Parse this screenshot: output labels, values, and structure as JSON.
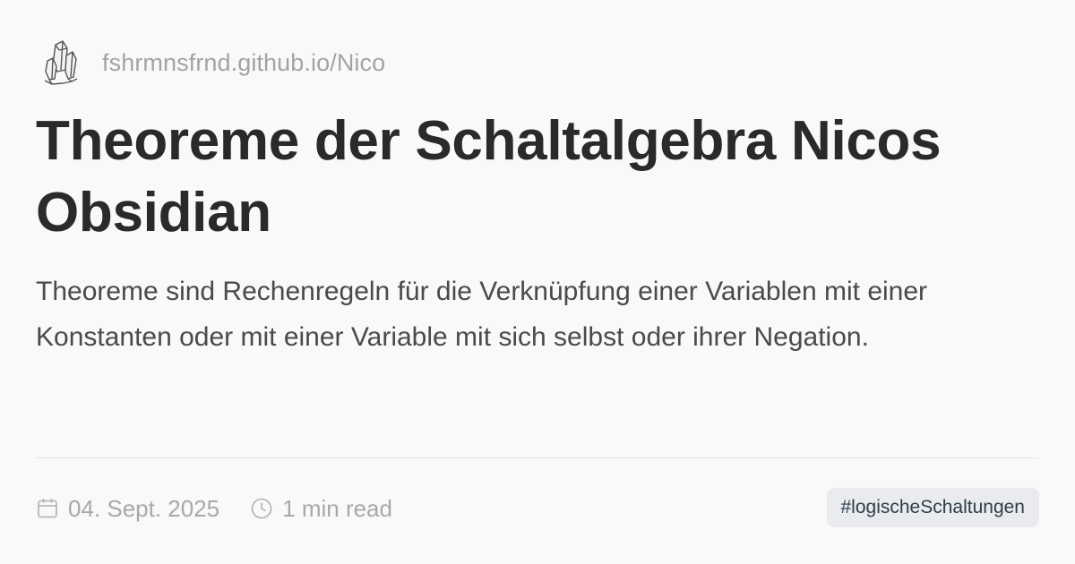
{
  "site": {
    "logo_icon": "crystal-icon",
    "url": "fshrmnsfrnd.github.io/Nico"
  },
  "article": {
    "title": "Theoreme der Schaltalgebra Nicos Obsidian",
    "description": "Theoreme sind Rechenregeln für die Verknüpfung einer Variablen mit einer Konstanten oder mit einer Variable mit sich selbst oder ihrer Negation."
  },
  "meta": {
    "date_icon": "calendar-icon",
    "date": "04. Sept. 2025",
    "reading_icon": "clock-icon",
    "reading_time": "1 min read",
    "tag": "#logischeSchaltungen"
  },
  "colors": {
    "background": "#faf9fa",
    "title": "#2a2a2a",
    "muted": "#a3a3a3",
    "tag_background": "#e9ebee",
    "tag_text": "#2f3e4c"
  }
}
